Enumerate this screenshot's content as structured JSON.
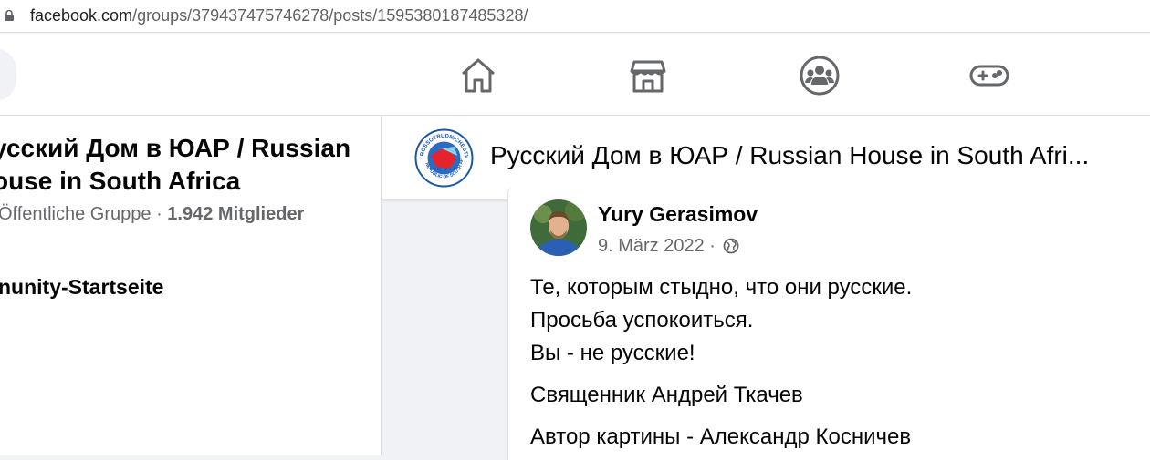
{
  "browser": {
    "url_host": "facebook.com",
    "url_path": "/groups/379437475746278/posts/1595380187485328/"
  },
  "nav": {
    "icons": [
      "home-icon",
      "marketplace-icon",
      "groups-icon",
      "gaming-icon"
    ],
    "icon_color": "#65676b"
  },
  "sidebar": {
    "group_title": "усский Дом в ЮАР / Russian\nouse in South Africa",
    "privacy": "Öffentliche Gruppe",
    "separator": " · ",
    "members": "1.942 Mitglieder",
    "community_link": "nunity-Startseite"
  },
  "group_header": {
    "logo_text": "ROSSOTRUDNICHESTVO · REPUBLIC OF SOUTH AFRICA",
    "name": "Русский Дом в ЮАР / Russian House in South Afri..."
  },
  "post": {
    "author": "Yury Gerasimov",
    "date": "9. März 2022",
    "date_separator": " · ",
    "audience_icon": "globe-icon",
    "lines": [
      "Те, которым стыдно, что они русские.",
      "Просьба успокоиться.",
      "Вы - не русские!"
    ],
    "signature": "Священник Андрей Ткачев",
    "art_credit": "Автор картины - Александр Косничев"
  },
  "colors": {
    "primary_text": "#050505",
    "secondary_text": "#65676b",
    "page_bg": "#f0f2f5",
    "surface": "#ffffff"
  }
}
